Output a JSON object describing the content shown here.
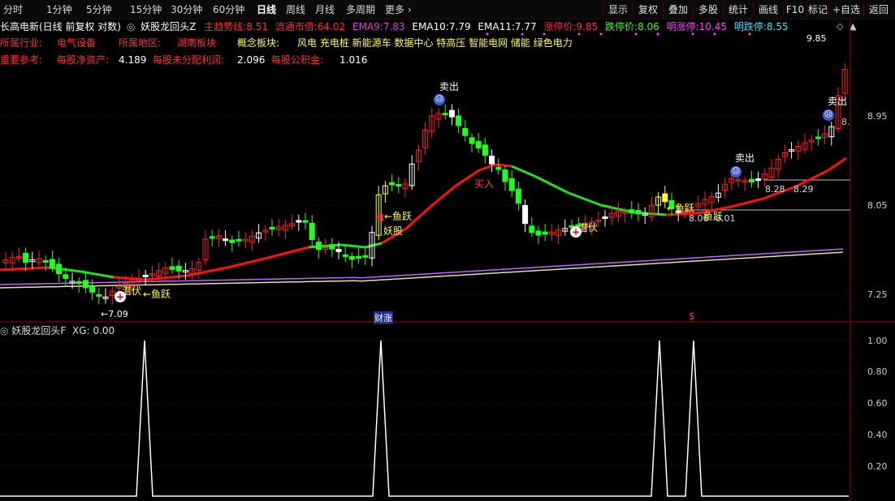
{
  "toolbar": {
    "periods": [
      "分时",
      "1分钟",
      "5分钟",
      "15分钟",
      "30分钟",
      "60分钟",
      "日线",
      "周线",
      "月线",
      "多周期",
      "更多"
    ],
    "active_period": "日线",
    "right_buttons": [
      "显示",
      "复权",
      "叠加",
      "多股",
      "统计",
      "画线",
      "F10",
      "标记",
      "+自选",
      "返回"
    ]
  },
  "header": {
    "stock_title": "长高电新(日线 前复权 对数)",
    "indicator_name": "妖股龙回头Z",
    "items": [
      {
        "label": "主趋势线:",
        "value": "8.51",
        "color": "#ff3030"
      },
      {
        "label": "流通市值:",
        "value": "64.02",
        "color": "#ff3030"
      },
      {
        "label": "EMA9:",
        "value": "7.83",
        "color": "#e040e0"
      },
      {
        "label": "EMA10:",
        "value": "7.79",
        "color": "#ffffff"
      },
      {
        "label": "EMA11:",
        "value": "7.77",
        "color": "#ffffff"
      },
      {
        "label": "涨停价:",
        "value": "9.85",
        "color": "#ff3030"
      },
      {
        "label": "跌停价:",
        "value": "8.06",
        "color": "#30ff30"
      },
      {
        "label": "明涨停:",
        "value": "10.45",
        "color": "#ff40ff"
      },
      {
        "label": "明跌停:",
        "value": "8.55",
        "color": "#40e0ff"
      }
    ]
  },
  "info": {
    "industry_label": "所属行业:",
    "industry": "电气设备",
    "region_label": "所属地区:",
    "region": "湖南板块",
    "concept_label": "概念板块:",
    "concepts": "风电 充电桩 新能源车 数据中心 特高压 智能电网 储能 绿色电力",
    "ref_label": "重要参考:",
    "nav_label": "每股净资产:",
    "nav": "4.189",
    "undist_label": "每股未分配利润:",
    "undist": "2.096",
    "reserve_label": "每股公积金:",
    "reserve": "1.016"
  },
  "annotations": {
    "sell": "卖出",
    "buy": "买入",
    "yuyue": "鱼跃",
    "yaogu": "妖股",
    "qianfu": "潜伏",
    "B": "B",
    "low_price": "←7.09",
    "high_price": "9.85",
    "level1": "8.28",
    "level2": "8.29",
    "level3": "8.06",
    "level4": "8.01",
    "caizhang": "财涨",
    "dollar": "$",
    "arrow_yuyue": "←鱼跃",
    "clipped_8": "8."
  },
  "price_axis": {
    "ticks": [
      "8.95",
      "8.05",
      "7.25"
    ]
  },
  "indicator": {
    "title": "妖股龙回头F",
    "xg_label": "XG:",
    "xg_value": "0.00",
    "ticks": [
      "1.00",
      "0.80",
      "0.60",
      "0.40",
      "0.20"
    ]
  },
  "chart_data": {
    "type": "line",
    "title": "妖股龙回头F",
    "series": [
      {
        "name": "XG",
        "spikes_at_candle_index": [
          24,
          64,
          110,
          116
        ],
        "spike_value": 1.0,
        "base_value": 0.0
      }
    ],
    "ylim": [
      0,
      1
    ]
  },
  "colors": {
    "up": "#ff2020",
    "down": "#20ff20",
    "trend_up": "#ff1010",
    "trend_down": "#20e020",
    "ema_a": "#e0e0a0",
    "ema_b": "#c060ff",
    "axis": "#a00000"
  }
}
